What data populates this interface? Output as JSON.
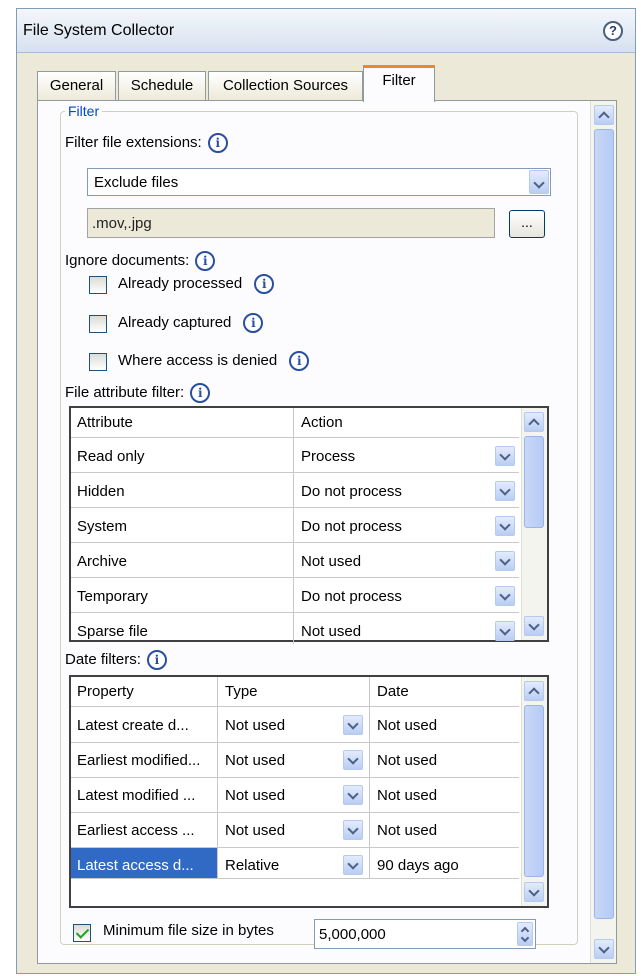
{
  "window": {
    "title": "File System Collector",
    "help_icon": "question-icon"
  },
  "tabs": [
    {
      "label": "General"
    },
    {
      "label": "Schedule"
    },
    {
      "label": "Collection Sources"
    },
    {
      "label": "Filter",
      "active": true
    }
  ],
  "filter": {
    "group_label": "Filter",
    "extensions_label": "Filter file extensions:",
    "mode_value": "Exclude files",
    "extensions_value": ".mov,.jpg",
    "browse_label": "...",
    "ignore_label": "Ignore documents:",
    "ignore_options": [
      {
        "label": "Already processed",
        "checked": false
      },
      {
        "label": "Already captured",
        "checked": false
      },
      {
        "label": "Where access is denied",
        "checked": false
      }
    ],
    "attr_filter_label": "File attribute filter:",
    "attr_columns": [
      "Attribute",
      "Action"
    ],
    "attr_rows": [
      {
        "attribute": "Read only",
        "action": "Process"
      },
      {
        "attribute": "Hidden",
        "action": "Do not process"
      },
      {
        "attribute": "System",
        "action": "Do not process"
      },
      {
        "attribute": "Archive",
        "action": "Not used"
      },
      {
        "attribute": "Temporary",
        "action": "Do not process"
      },
      {
        "attribute": "Sparse file",
        "action": "Not used"
      }
    ],
    "date_filters_label": "Date filters:",
    "date_columns": [
      "Property",
      "Type",
      "Date"
    ],
    "date_rows": [
      {
        "property": "Latest create d...",
        "type": "Not used",
        "date": "Not used"
      },
      {
        "property": "Earliest modified...",
        "type": "Not used",
        "date": "Not used"
      },
      {
        "property": "Latest modified ...",
        "type": "Not used",
        "date": "Not used"
      },
      {
        "property": "Earliest access ...",
        "type": "Not used",
        "date": "Not used"
      },
      {
        "property": "Latest access d...",
        "type": "Relative",
        "date": "90 days ago",
        "selected": true
      }
    ],
    "min_size_label": "Minimum file size in bytes",
    "min_size_checked": true,
    "min_size_value": "5,000,000"
  },
  "colors": {
    "tab_accent": "#e68b2c",
    "selection": "#316ac5",
    "group_label": "#0046d5"
  }
}
